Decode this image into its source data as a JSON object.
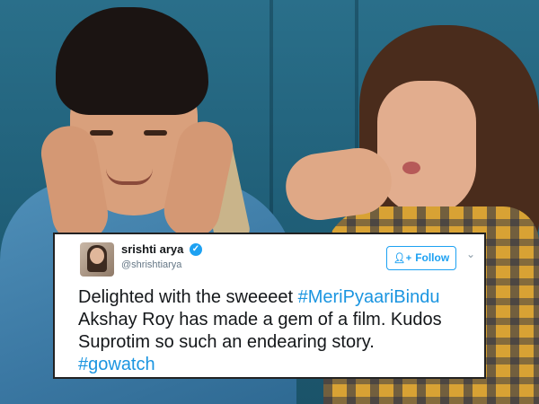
{
  "tweet": {
    "name": "srishti arya",
    "handle": "@shrishtiarya",
    "follow_label": "Follow",
    "lines": [
      {
        "parts": [
          {
            "text": "Delighted with the sweeeet ",
            "hashtag": false
          },
          {
            "text": "#MeriPyaariBindu",
            "hashtag": true
          }
        ]
      },
      {
        "parts": [
          {
            "text": "Akshay Roy has made a gem of a film. Kudos",
            "hashtag": false
          }
        ]
      },
      {
        "parts": [
          {
            "text": "Suprotim so such an endearing story.",
            "hashtag": false
          }
        ]
      },
      {
        "parts": [
          {
            "text": "#gowatch",
            "hashtag": true
          }
        ]
      }
    ]
  },
  "icons": {
    "verified": "verified-badge-icon",
    "follow": "add-user-icon",
    "more": "chevron-down-icon"
  },
  "colors": {
    "accent": "#1da1f2",
    "hashtag": "#1b95e0",
    "text": "#14171a",
    "muted": "#657786"
  }
}
